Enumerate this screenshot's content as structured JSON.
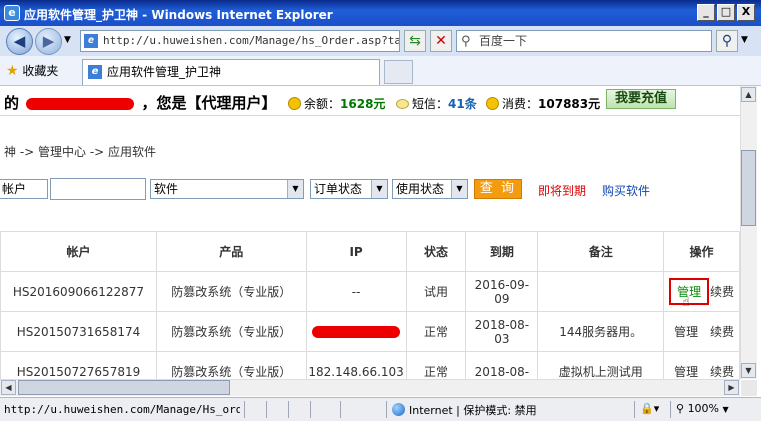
{
  "window": {
    "title": "应用软件管理_护卫神 - Windows Internet Explorer",
    "minimize": "_",
    "restore": "□",
    "close": "X"
  },
  "toolbar": {
    "url": "http://u.huweishen.com/Manage/hs_Order.asp?tag",
    "search_placeholder": "百度一下"
  },
  "favorites": {
    "label": "收藏夹",
    "tab_title": "应用软件管理_护卫神"
  },
  "header": {
    "greeting_prefix": "的",
    "greeting_suffix": "，您是【代理用户】",
    "balance_label": "余额：",
    "balance_value": "1628元",
    "sms_label": "短信：",
    "sms_value": "41条",
    "spend_label": "消费：",
    "spend_value": "107883元",
    "recharge_button": "我要充值"
  },
  "breadcrumb": "神 -> 管理中心 -> 应用软件",
  "filters": {
    "account_select": "帐户",
    "software_select": "软件",
    "order_status_select": "订单状态",
    "use_status_select": "使用状态",
    "query_button": "查 询",
    "expiring_link": "即将到期",
    "buy_link": "购买软件"
  },
  "table": {
    "columns": [
      "帐户",
      "产品",
      "IP",
      "状态",
      "到期",
      "备注",
      "操作"
    ],
    "rows": [
      {
        "account": "HS201609066122877",
        "product": "防篡改系统（专业版）",
        "ip": "--",
        "status": "试用",
        "status_type": "try",
        "expiry_line1": "2016-09-",
        "expiry_line2": "09",
        "note": "",
        "manage": "管理",
        "renew": "续费"
      },
      {
        "account": "HS20150731658174",
        "product": "防篡改系统（专业版）",
        "ip": "",
        "status": "正常",
        "status_type": "ok",
        "expiry_line1": "2018-08-",
        "expiry_line2": "03",
        "note": "144服务器用。",
        "manage": "管理",
        "renew": "续费"
      },
      {
        "account": "HS20150727657819",
        "product": "防篡改系统（专业版）",
        "ip": "182.148.66.103",
        "status": "正常",
        "status_type": "ok",
        "expiry_line1": "2018-08-",
        "expiry_line2": "",
        "note": "虚拟机上测试用",
        "manage": "管理",
        "renew": "续费"
      }
    ]
  },
  "statusbar": {
    "url": "http://u.huweishen.com/Manage/Hs_orderM",
    "zone": "Internet | 保护模式: 禁用",
    "zoom": "100%"
  },
  "colors": {
    "title_bar": "#1f5ed8",
    "query_button": "#f39c12",
    "status_ok": "#0a8a0a",
    "status_try": "#1148b5",
    "link_red": "#dd0000"
  }
}
